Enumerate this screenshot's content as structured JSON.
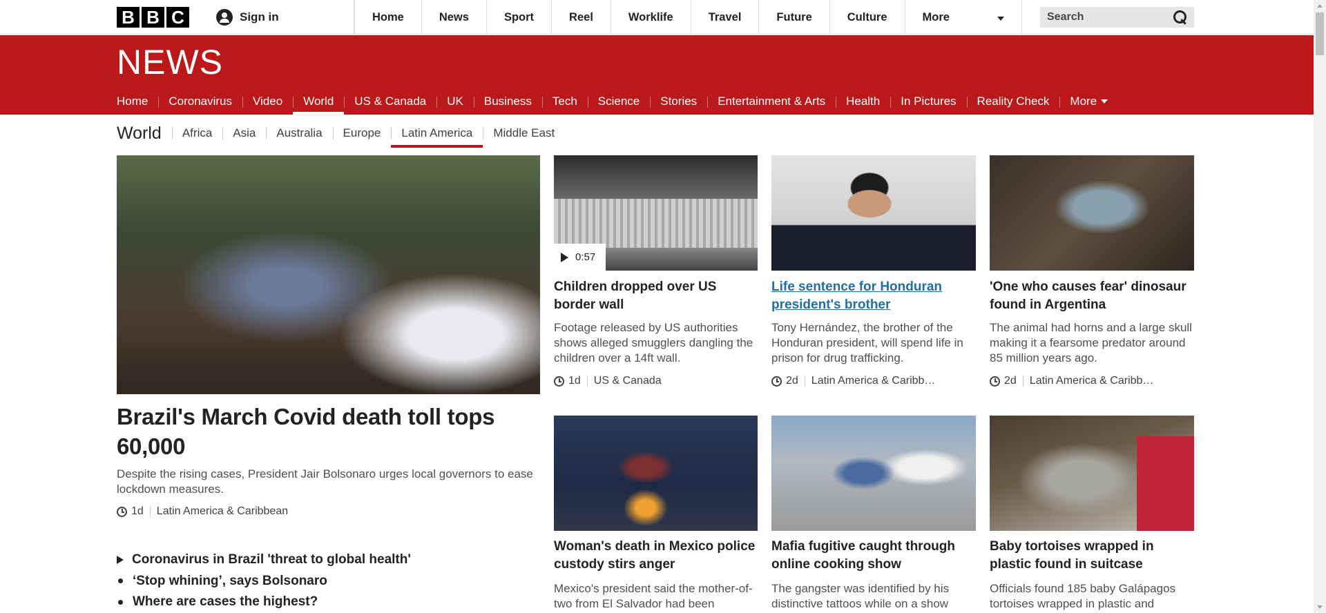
{
  "top": {
    "logo": [
      "B",
      "B",
      "C"
    ],
    "signin": "Sign in",
    "nav": [
      "Home",
      "News",
      "Sport",
      "Reel",
      "Worklife",
      "Travel",
      "Future",
      "Culture"
    ],
    "more": "More",
    "search_placeholder": "Search"
  },
  "news": {
    "title": "NEWS",
    "nav": [
      "Home",
      "Coronavirus",
      "Video",
      "World",
      "US & Canada",
      "UK",
      "Business",
      "Tech",
      "Science",
      "Stories",
      "Entertainment & Arts",
      "Health",
      "In Pictures",
      "Reality Check"
    ],
    "active": "World",
    "more": "More"
  },
  "world": {
    "title": "World",
    "nav": [
      "Africa",
      "Asia",
      "Australia",
      "Europe",
      "Latin America",
      "Middle East"
    ],
    "active": "Latin America"
  },
  "lead": {
    "title": "Brazil's March Covid death toll tops 60,000",
    "summary": "Despite the rising cases, President Jair Bolsonaro urges local governors to ease lockdown measures.",
    "time": "1d",
    "section": "Latin America & Caribbean",
    "related": [
      "Coronavirus in Brazil 'threat to global health'",
      "‘Stop whining’, says Bolsonaro",
      "Where are cases the highest?"
    ]
  },
  "cards": [
    {
      "title": "Children dropped over US border wall",
      "summary": "Footage released by US authorities shows alleged smugglers dangling the children over a 14ft wall.",
      "time": "1d",
      "section": "US & Canada",
      "video_duration": "0:57"
    },
    {
      "title": "Life sentence for Honduran president's brother",
      "summary": "Tony Hernández, the brother of the Honduran president, will spend life in prison for drug trafficking.",
      "time": "2d",
      "section": "Latin America & Caribb…"
    },
    {
      "title": "'One who causes fear' dinosaur found in Argentina",
      "summary": "The animal had horns and a large skull making it a fearsome predator around 85 million years ago.",
      "time": "2d",
      "section": "Latin America & Caribb…"
    },
    {
      "title": "Woman's death in Mexico police custody stirs anger",
      "summary": "Mexico's president said the mother-of-two from El Salvador had been"
    },
    {
      "title": "Mafia fugitive caught through online cooking show",
      "summary": "The gangster was identified by his distinctive tattoos while on a show"
    },
    {
      "title": "Baby tortoises wrapped in plastic found in suitcase",
      "summary": "Officials found 185 baby Galápagos tortoises wrapped in plastic and"
    }
  ],
  "colors": {
    "brand_red": "#bb1919",
    "link_blue": "#1f6fa1"
  }
}
